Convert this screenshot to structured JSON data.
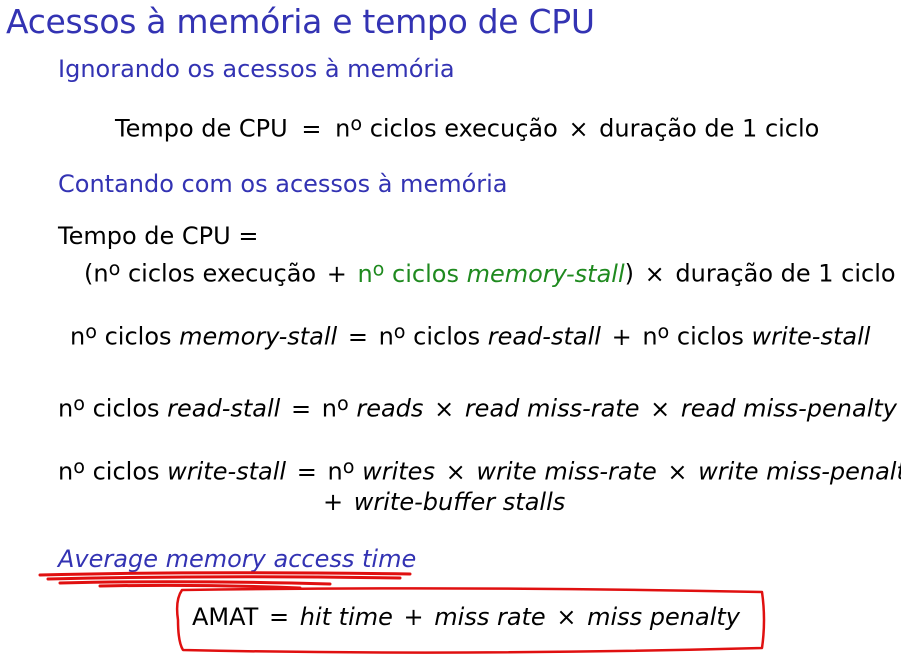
{
  "title": "Acessos à memória e tempo de CPU",
  "section1": {
    "heading": "Ignorando os acessos à memória",
    "formula": {
      "lhs": "Tempo de CPU",
      "eq": "=",
      "n": "n",
      "o": "o",
      "t1": " ciclos execução ",
      "times": "×",
      "t2": " duração de 1 ciclo"
    }
  },
  "section2": {
    "heading": "Contando com os acessos à memória",
    "cpu_line1": "Tempo de CPU =",
    "cpu_line2": {
      "open": "(",
      "n": "n",
      "o": "o",
      "t1": " ciclos execução ",
      "plus": "+",
      "green_n": " n",
      "green_o": "o",
      "green_t": " ciclos ",
      "green_it": "memory-stall",
      "close": ")",
      "times": "×",
      "t2": " duração de 1 ciclo"
    },
    "stall": {
      "n1": "n",
      "o1": "o",
      "t1": " ciclos ",
      "i1": "memory-stall",
      "eq": "=",
      "n2": "n",
      "o2": "o",
      "t2": " ciclos ",
      "i2": "read-stall",
      "plus": "+",
      "n3": "n",
      "o3": "o",
      "t3": " ciclos ",
      "i3": "write-stall"
    },
    "read": {
      "n1": "n",
      "o1": "o",
      "t1": " ciclos ",
      "i1": "read-stall",
      "eq": "=",
      "n2": "n",
      "o2": "o",
      "i2": " reads",
      "x1": "×",
      "i3": "read miss-rate",
      "x2": "×",
      "i4": "read miss-penalty"
    },
    "write": {
      "n1": "n",
      "o1": "o",
      "t1": " ciclos ",
      "i1": "write-stall",
      "eq": "=",
      "n2": "n",
      "o2": "o",
      "i2": " writes",
      "x1": "×",
      "i3": "write miss-rate",
      "x2": "×",
      "i4": "write miss-penalty",
      "plus": "+",
      "i5": "write-buffer stalls"
    }
  },
  "section3": {
    "heading": "Average memory access time",
    "amat": {
      "lhs": "AMAT",
      "eq": "=",
      "i1": "hit time",
      "plus": "+",
      "i2": "miss rate",
      "times": "×",
      "i3": "miss penalty"
    }
  },
  "colors": {
    "heading_blue": "#3333b3",
    "green_term": "#1f8a1f",
    "annotation_red": "#e01010"
  }
}
